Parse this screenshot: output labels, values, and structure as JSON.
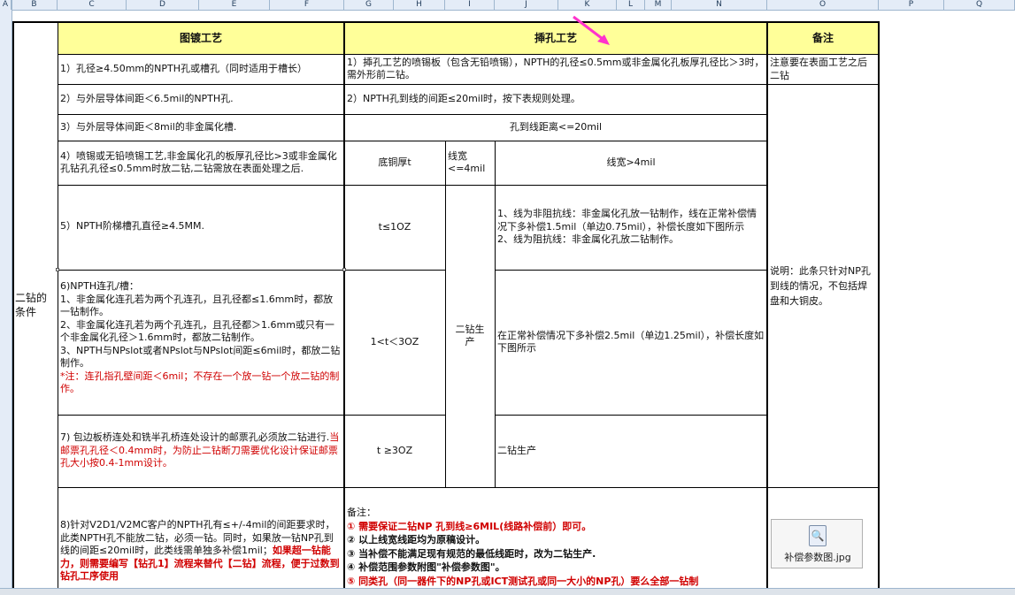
{
  "columns": [
    "A",
    "B",
    "C",
    "D",
    "E",
    "F",
    "G",
    "H",
    "I",
    "J",
    "K",
    "L",
    "M",
    "N",
    "O",
    "P",
    "Q"
  ],
  "headers": {
    "left": "图镀工艺",
    "mid": "揷孔工艺",
    "right": "备注"
  },
  "section_label": "二钻的条件",
  "left_rules": {
    "r1": "1）孔径≥4.50mm的NPTH孔或槽孔（同时适用于槽长）",
    "r2": "2）与外层导体间距＜6.5mil的NPTH孔.",
    "r3": "3）与外层导体间距＜8mil的非金属化槽.",
    "r4": "4）喷锡或无铅喷锡工艺,非金属化孔的板厚孔径比>3或非金属化孔钻孔孔径≤0.5mm时放二钻,二钻需放在表面处理之后.",
    "r5": "5）NPTH阶梯槽孔直径≥4.5MM.",
    "r6_lines": [
      "6)NPTH连孔/槽：",
      "1、非金属化连孔若为两个孔连孔，且孔径都≤1.6mm时，都放一钻制作。",
      "2、非金属化连孔若为两个孔连孔，且孔径都＞1.6mm或只有一个非金属化孔径＞1.6mm时，都放二钻制作。",
      "3、NPTH与NPslot或者NPslot与NPslot间距≤6mil时，都放二钻制作。"
    ],
    "r6_note": "*注：连孔指孔壁间距＜6mil；不存在一个放一钻一个放二钻的制作。",
    "r7_prefix": "7) 包边板桥连处和铣半孔桥连处设计的邮票孔必须放二钻进行.",
    "r7_red": "当邮票孔孔径＜0.4mm时，为防止二钻断刀需要优化设计保证邮票孔大小按0.4-1mm设计。",
    "r8_prefix": "8)针对V2D1/V2MC客户的NPTH孔有≤+/-4mil的间距要求时，此类NPTH孔不能放二钻，必须一钻。同时，如果放一钻NP孔到线的间距≤20mil时，此类线需单独多补偿1mil；",
    "r8_red": "如果超一钻能力，则需要编写【钻孔1】流程来替代【二钻】流程，便于过数到钻孔工序使用"
  },
  "mid_rules": {
    "r1": "1）揷孔工艺的喷锡板（包含无铅喷锡），NPTH的孔径≤0.5mm或非金属化孔板厚孔径比＞3时，需外形前二钻。",
    "r2": "2）NPTH孔到线的间距≤20mil时，按下表规则处理。",
    "subtitle": "孔到线距离<=20mil",
    "col_copper": "底铜厚t",
    "col_narrow": "线宽<=4mil",
    "col_wide": "线宽>4mil",
    "row1_t": "t≤1OZ",
    "row1_text": "1、线为非阻抗线：非金属化孔放一钻制作，线在正常补偿情况下多补偿1.5mil（单边0.75mil），补偿长度如下图所示\n2、线为阻抗线：非金属化孔放二钻制作。",
    "row2_t": "1<t＜3OZ",
    "row2_text": "在正常补偿情况下多补偿2.5mil（单边1.25mil），补偿长度如下图所示",
    "row3_t": "t  ≥3OZ",
    "row3_text": "二钻生产",
    "merged_narrow": "二钻生产",
    "notes_title": "备注：",
    "notes": [
      {
        "mark": "①",
        "text": "需要保证二钻NP  孔到线≥6MIL(线路补偿前）即可。",
        "red": true
      },
      {
        "mark": "②",
        "text": "以上线宽线距均为原稿设计。",
        "red": false
      },
      {
        "mark": "③",
        "text": "当补偿不能满足现有规范的最低线距时，改为二钻生产.",
        "red": false
      },
      {
        "mark": "④",
        "text": "补偿范围参数附图\"补偿参数图\"。",
        "red": false
      },
      {
        "mark": "⑤",
        "text": "同类孔（同一器件下的NP孔或ICT测试孔或同一大小的NP孔）要么全部一钻制",
        "red": true
      }
    ]
  },
  "right_notes": {
    "r1": "注意要在表面工艺之后二钻",
    "r2": "说明：此条只针对NP孔到线的情况，不包括焊盘和大铜皮。"
  },
  "attachment": {
    "filename": "补偿参数图.jpg",
    "icon": "image-file-icon"
  }
}
